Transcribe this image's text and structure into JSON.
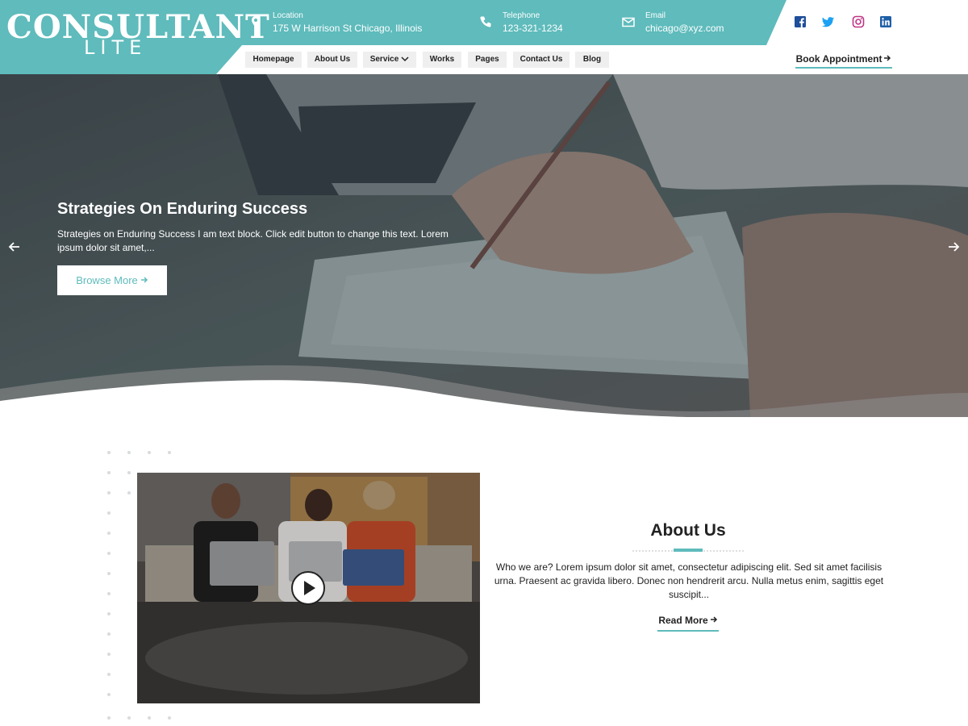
{
  "brand": {
    "logo_main": "CONSULTANT",
    "logo_sub": "LITE",
    "accent_color": "#5fbbbc"
  },
  "header": {
    "contacts": [
      {
        "icon": "map-pin-icon",
        "label": "Location",
        "value": "175 W Harrison St Chicago, Illinois"
      },
      {
        "icon": "phone-icon",
        "label": "Telephone",
        "value": "123-321-1234"
      },
      {
        "icon": "envelope-icon",
        "label": "Email",
        "value": "chicago@xyz.com"
      }
    ],
    "socials": [
      "facebook-icon",
      "twitter-icon",
      "instagram-icon",
      "linkedin-icon"
    ],
    "nav": [
      {
        "label": "Homepage"
      },
      {
        "label": "About Us"
      },
      {
        "label": "Service",
        "has_dropdown": true
      },
      {
        "label": "Works"
      },
      {
        "label": "Pages"
      },
      {
        "label": "Contact Us"
      },
      {
        "label": "Blog"
      }
    ],
    "cta": "Book Appointment"
  },
  "hero": {
    "title": "Strategies On Enduring Success",
    "text": "Strategies on Enduring Success I am text block. Click edit button to change this text. Lorem ipsum dolor sit amet,...",
    "button": "Browse More"
  },
  "about": {
    "title": "About Us",
    "text": "Who we are? Lorem ipsum dolor sit amet, consectetur adipiscing elit. Sed sit amet facilisis urna. Praesent ac gravida libero. Donec non hendrerit arcu. Nulla metus enim, sagittis eget suscipit...",
    "button": "Read More"
  }
}
